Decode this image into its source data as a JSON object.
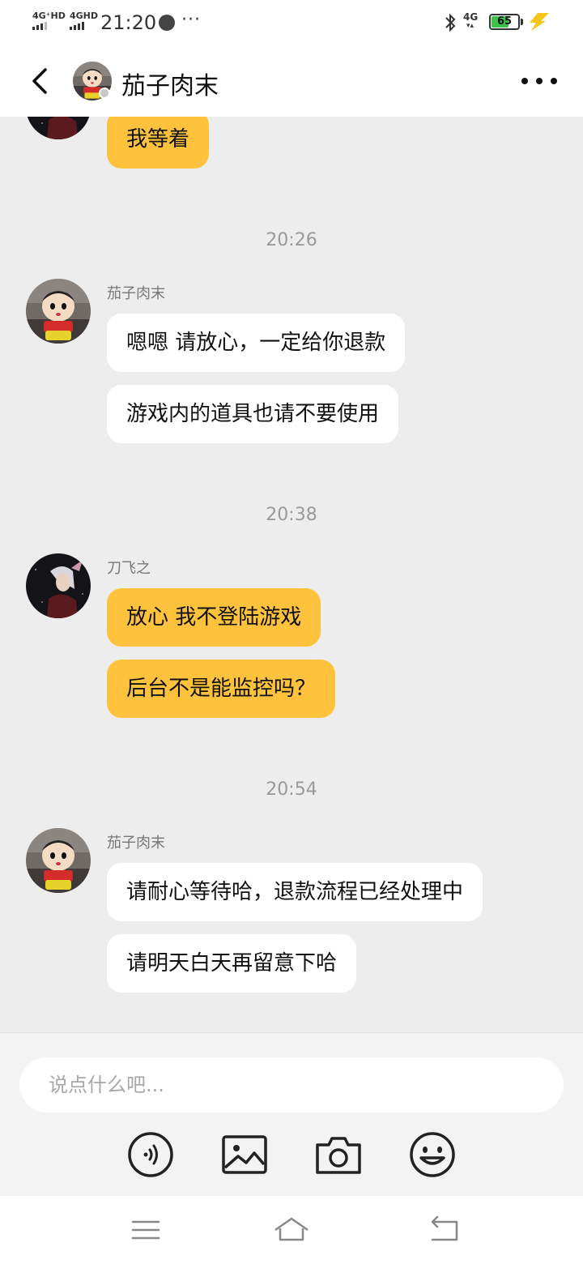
{
  "status_bar": {
    "net1": "4G⁺HD",
    "net2": "4GHD",
    "time": "21:20",
    "more": "···",
    "net3": "4G",
    "battery": "65",
    "battery_level": 0.65
  },
  "header": {
    "title": "茄子肉末"
  },
  "chat": {
    "top_partial_message": "我等着",
    "groups": [
      {
        "time": "20:26",
        "sender": "茄子肉末",
        "messages": [
          "嗯嗯 请放心，一定给你退款",
          "游戏内的道具也请不要使用"
        ]
      },
      {
        "time": "20:38",
        "sender": "刀飞之",
        "messages": [
          "放心 我不登陆游戏",
          "后台不是能监控吗？"
        ]
      },
      {
        "time": "20:54",
        "sender": "茄子肉末",
        "messages": [
          "请耐心等待哈，退款流程已经处理中",
          "请明天白天再留意下哈"
        ]
      }
    ]
  },
  "composer": {
    "placeholder": "说点什么吧...",
    "tools": [
      "voice-icon",
      "image-icon",
      "camera-icon",
      "emoji-icon"
    ]
  },
  "nav_bar": {
    "icons": [
      "menu-icon",
      "home-icon",
      "back-icon"
    ]
  },
  "colors": {
    "mine_bubble": "#ffc23d",
    "theirs_bubble": "#ffffff",
    "chat_bg": "#ededed",
    "battery": "#3cc24a"
  }
}
